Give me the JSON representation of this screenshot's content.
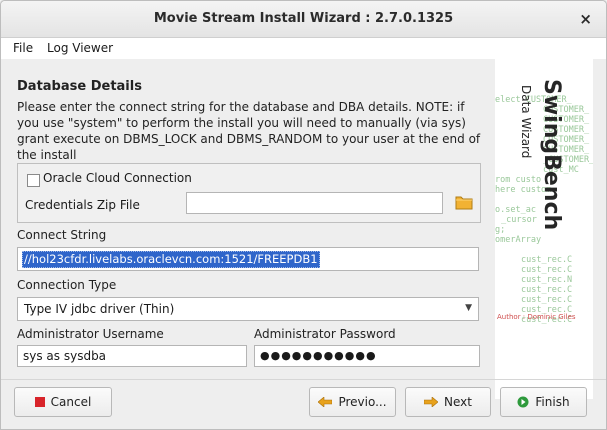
{
  "window": {
    "title": "Movie Stream Install Wizard : 2.7.0.1325",
    "close_glyph": "×"
  },
  "menu": {
    "items": [
      "File",
      "Log Viewer"
    ]
  },
  "section": {
    "title": "Database Details",
    "description": "Please enter the connect string for the database and DBA details. NOTE: if you use \"system\" to perform the install you will need to manually (via sys) grant execute on DBMS_LOCK and DBMS_RANDOM to your user at the end of the install"
  },
  "cloud": {
    "checkbox_label": "Oracle Cloud Connection",
    "checked": false,
    "zip_label": "Credentials Zip File",
    "zip_value": ""
  },
  "connect": {
    "label": "Connect String",
    "value": "//hol23cfdr.livelabs.oraclevcn.com:1521/FREEPDB1"
  },
  "connection_type": {
    "label": "Connection Type",
    "selected": "Type IV jdbc driver (Thin)"
  },
  "admin": {
    "username_label": "Administrator Username",
    "username_value": "sys as sysdba",
    "password_label": "Administrator Password",
    "password_mask": "●●●●●●●●●●●"
  },
  "side_panel": {
    "brand": "SwingBench",
    "subtitle": "Data Wizard",
    "author": "Author : Dominic Giles",
    "code_lines": [
      "elect CUSTOMER_",
      "CUSTOMER_",
      "CUSTOMER_",
      "CUSTOMER_",
      "CUSTOMER_",
      "CUSTOMER_",
      "_CUSTOMER_",
      "cust_MC",
      "rom custo",
      "here custom",
      "",
      "o.set_ac",
      "_cursor",
      "g;",
      "omerArray",
      "",
      "cust_rec.C",
      "cust_rec.C",
      "cust_rec.N",
      "cust_rec.C",
      "cust_rec.C",
      "cust_rec.C",
      "cust_rec.C"
    ]
  },
  "buttons": {
    "cancel": "Cancel",
    "previous": "Previo...",
    "next": "Next",
    "finish": "Finish"
  },
  "colors": {
    "selection": "#2f65ca",
    "cancel_icon": "#d8242a",
    "arrow_icon": "#e8a21c",
    "finish_icon": "#2e9a3c",
    "folder_icon": "#f2b233",
    "code_text": "#9ac89a"
  }
}
